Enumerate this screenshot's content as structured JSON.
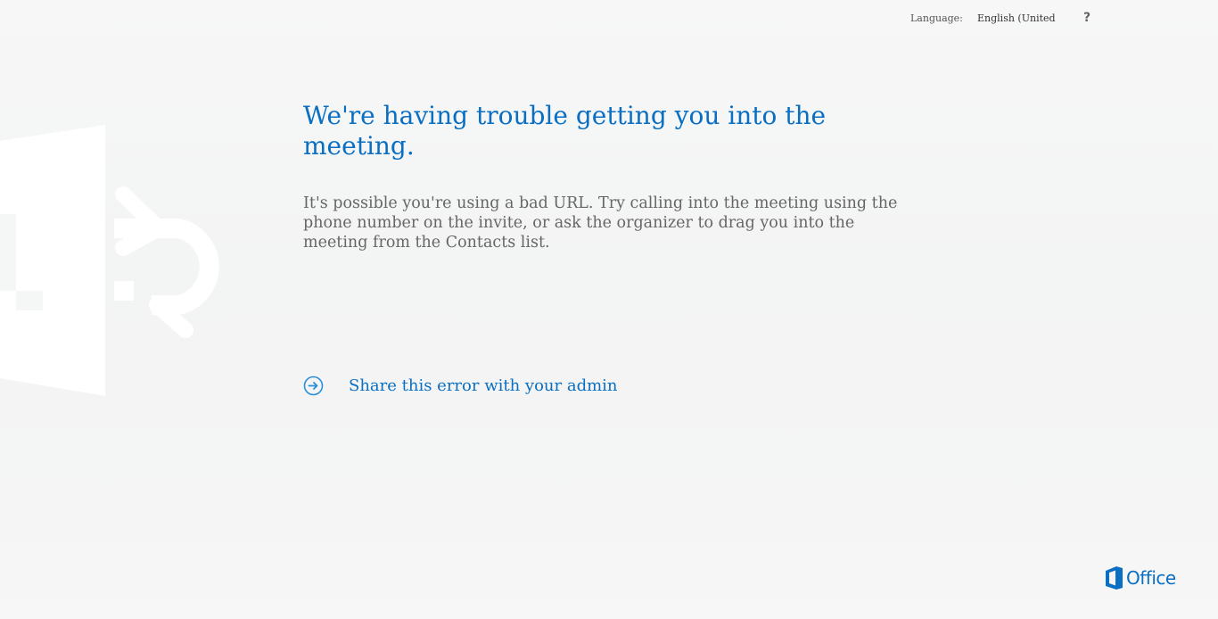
{
  "header": {
    "language_label": "Language:",
    "language_value": "English (United",
    "help_label": "?"
  },
  "error": {
    "title": "We're having trouble getting you into the meeting.",
    "message": "It's possible you're using a bad URL. Try calling into the meeting using the phone number on the invite, or ask the organizer to drag you into the meeting from the Contacts list."
  },
  "actions": {
    "share_label": "Share this error with your admin",
    "share_icon": "arrow-right-circle-icon"
  },
  "footer": {
    "brand_word": "Office",
    "brand_icon": "office-logo-icon"
  },
  "colors": {
    "accent": "#0a6fc2",
    "background": "#f5f5f5",
    "body_text": "#666666"
  }
}
